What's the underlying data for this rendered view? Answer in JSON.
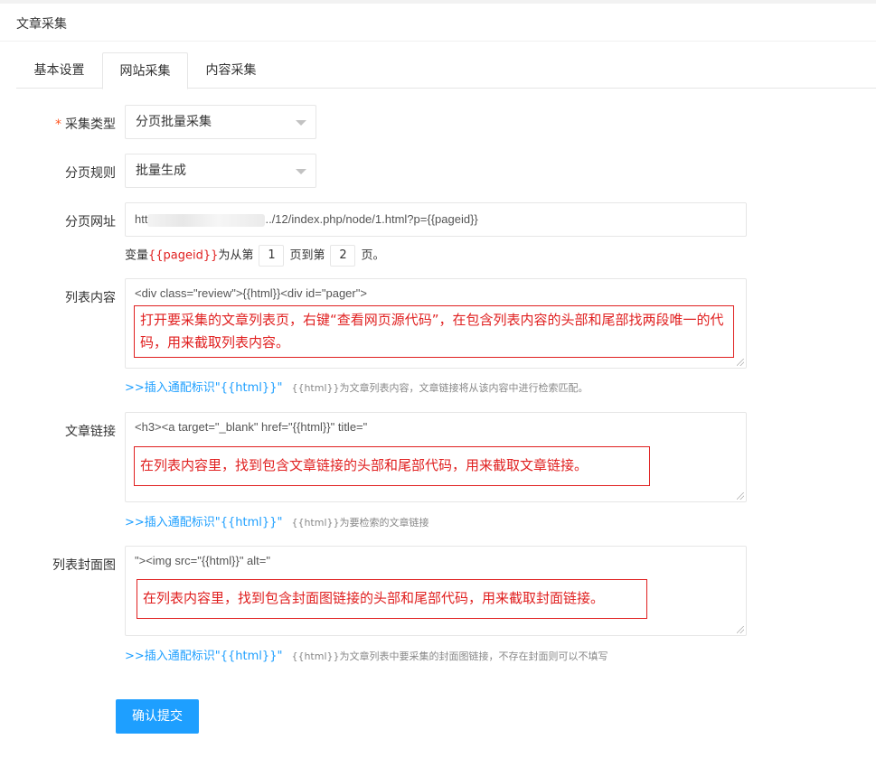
{
  "card": {
    "title": "文章采集"
  },
  "tabs": [
    {
      "label": "基本设置"
    },
    {
      "label": "网站采集"
    },
    {
      "label": "内容采集"
    }
  ],
  "form": {
    "collect_type": {
      "label": "采集类型",
      "required_mark": "*",
      "value": "分页批量采集"
    },
    "page_rule": {
      "label": "分页规则",
      "value": "批量生成"
    },
    "page_url": {
      "label": "分页网址",
      "value_prefix": "htt",
      "value_suffix": "../12/index.php/node/1.html?p={{pageid}}"
    },
    "page_range": {
      "prefix": "变量",
      "var": "{{pageid}}",
      "mid1": "为从第",
      "from": "1",
      "mid2": "页到第",
      "to": "2",
      "suffix": "页。"
    },
    "list_content": {
      "label": "列表内容",
      "value": "<div class=\"review\">{{html}}<div id=\"pager\">",
      "note": "打开要采集的文章列表页，右键“查看网页源代码”，在包含列表内容的头部和尾部找两段唯一的代码，用来截取列表内容。",
      "insert_link": ">>插入通配标识\"{{html}}\"",
      "desc": "{{html}}为文章列表内容，文章链接将从该内容中进行检索匹配。"
    },
    "article_link": {
      "label": "文章链接",
      "value": "<h3><a target=\"_blank\" href=\"{{html}}\" title=\"",
      "note": "在列表内容里，找到包含文章链接的头部和尾部代码，用来截取文章链接。",
      "insert_link": ">>插入通配标识\"{{html}}\"",
      "desc": "{{html}}为要检索的文章链接"
    },
    "cover_image": {
      "label": "列表封面图",
      "value": "\"><img src=\"{{html}}\" alt=\"",
      "note": "在列表内容里，找到包含封面图链接的头部和尾部代码，用来截取封面链接。",
      "insert_link": ">>插入通配标识\"{{html}}\"",
      "desc": "{{html}}为文章列表中要采集的封面图链接，不存在封面则可以不填写"
    },
    "submit_label": "确认提交"
  },
  "colors": {
    "primary": "#1e9fff",
    "note_red": "#e02020",
    "required": "#ff5722"
  }
}
